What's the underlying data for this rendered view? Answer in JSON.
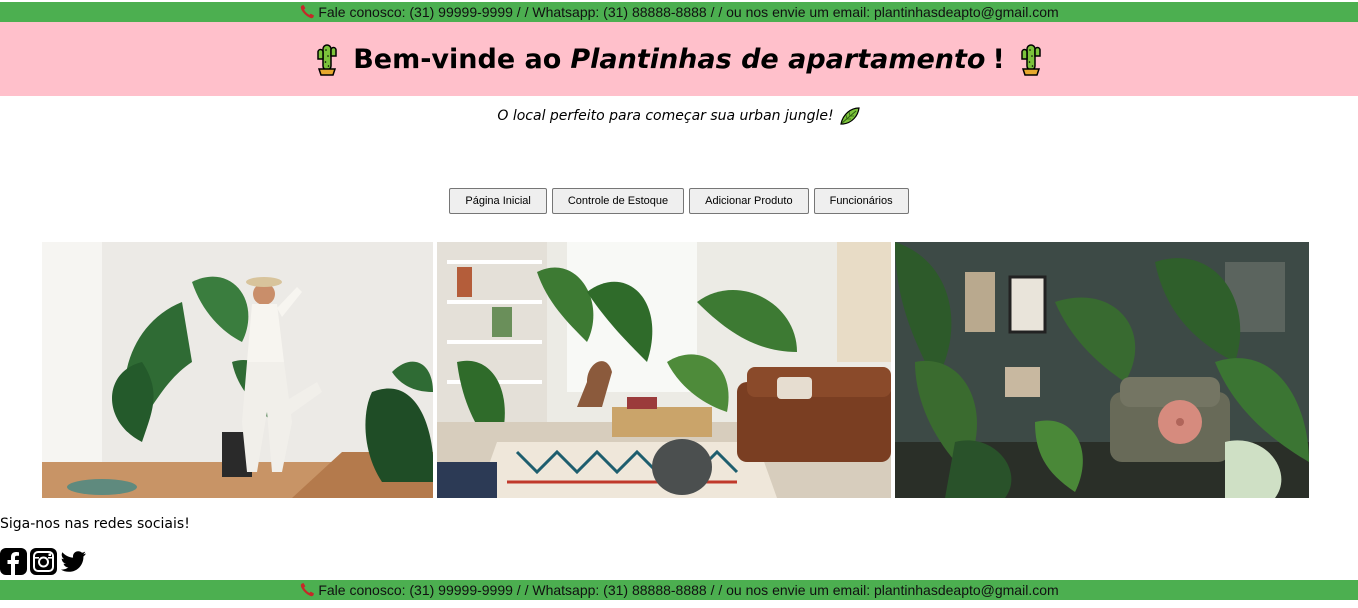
{
  "contact_bar": {
    "text": "Fale conosco: (31) 99999-9999 / / Whatsapp: (31) 88888-8888 / / ou nos envie um email: plantinhasdeapto@gmail.com",
    "icon": "phone-icon",
    "background": "#4caf50"
  },
  "hero": {
    "prefix": "Bem-vinde ao",
    "brand": "Plantinhas de apartamento",
    "suffix": "!",
    "icon": "cactus-icon",
    "background": "#ffc0cb"
  },
  "tagline": {
    "text": "O local perfeito para começar sua urban jungle!",
    "icon": "leaf-icon"
  },
  "nav": {
    "home": "Página Inicial",
    "stock": "Controle de Estoque",
    "add_product": "Adicionar Produto",
    "employees": "Funcionários"
  },
  "gallery": [
    "woman-with-plants-photo",
    "living-room-plants-photo",
    "plant-filled-room-photo"
  ],
  "social": {
    "label": "Siga-nos nas redes sociais!",
    "icons": [
      "facebook-icon",
      "instagram-icon",
      "twitter-icon"
    ]
  }
}
